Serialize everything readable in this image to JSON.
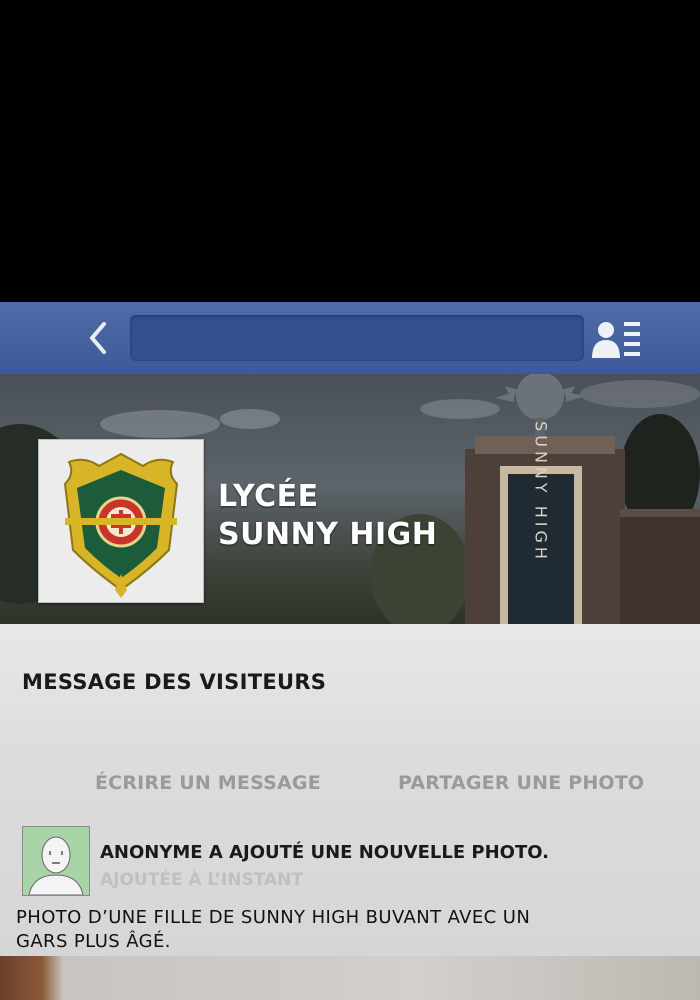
{
  "navbar": {
    "back_icon": "chevron-left-icon",
    "profile_icon": "person-list-icon",
    "search": {
      "value": "",
      "placeholder": ""
    },
    "color": "#3f5c9a"
  },
  "header": {
    "logo": "school-crest",
    "name_line1": "LYCÉE",
    "name_line2": "SUNNY HIGH",
    "sign_text": "SUNNY HIGH"
  },
  "visitors": {
    "section_title": "MESSAGE DES VISITEURS",
    "write_label": "ÉCRIRE UN MESSAGE",
    "share_label": "PARTAGER UNE PHOTO"
  },
  "post": {
    "avatar_icon": "default-avatar-icon",
    "title": "ANONYME A AJOUTÉ UNE NOUVELLE PHOTO.",
    "time": "AJOUTÉE À L’INSTANT",
    "body_line1": "PHOTO D’UNE FILLE DE SUNNY HIGH BUVANT AVEC UN",
    "body_line2": "GARS PLUS ÂGÉ."
  }
}
